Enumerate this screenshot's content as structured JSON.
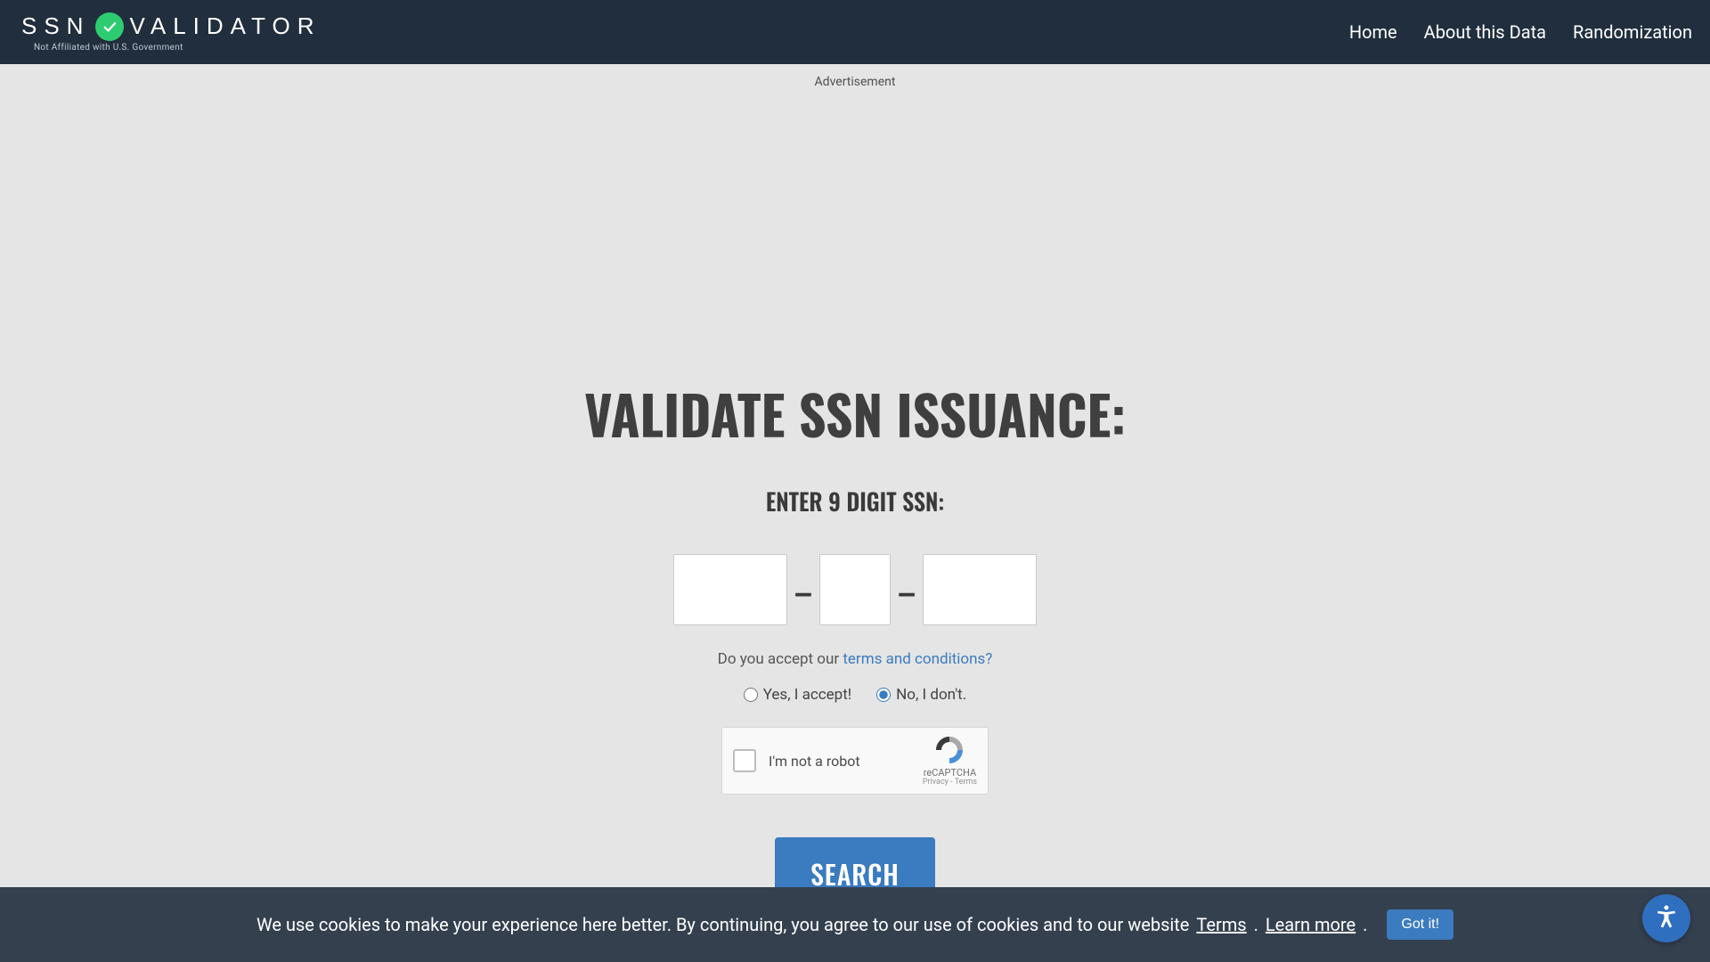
{
  "header": {
    "logo_part_a": "SSN",
    "logo_part_b": "VALIDATOR",
    "logo_subtitle": "Not Affiliated with U.S. Government",
    "nav": {
      "home": "Home",
      "about": "About this Data",
      "random": "Randomization"
    }
  },
  "ad": {
    "label": "Advertisement"
  },
  "main": {
    "title": "VALIDATE SSN ISSUANCE:",
    "subtitle": "ENTER 9 DIGIT SSN:",
    "dash": "–",
    "ssn_a": "",
    "ssn_b": "",
    "ssn_c": "",
    "terms_prefix": "Do you accept our ",
    "terms_link": "terms and conditions?",
    "radio_yes": "Yes, I accept!",
    "radio_no": "No, I don't.",
    "radio_selected": "no",
    "recaptcha": {
      "label": "I'm not a robot",
      "brand": "reCAPTCHA",
      "sub": "Privacy - Terms"
    },
    "search_label": "SEARCH"
  },
  "cookie": {
    "text": "We use cookies to make your experience here better. By continuing, you agree to our use of cookies and to our website",
    "terms_link": " Terms",
    "sep": ". ",
    "learn_link": "Learn more",
    "end": ".",
    "button": "Got it!"
  },
  "colors": {
    "header_bg": "#212e3d",
    "page_bg": "#e5e5e5",
    "accent_blue": "#3b7bbf",
    "accent_green": "#2ecc71",
    "cookie_bg": "#34404e"
  }
}
